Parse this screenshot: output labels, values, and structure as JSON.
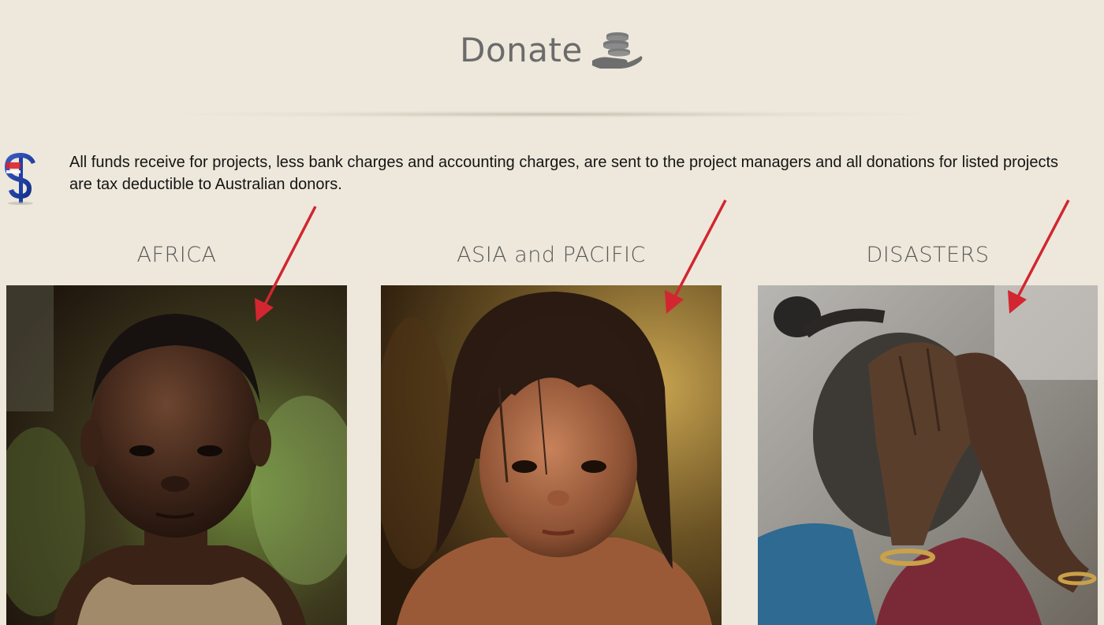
{
  "header": {
    "title": "Donate",
    "icon": "hand-coins-icon"
  },
  "intro": {
    "icon": "dollar-sign-icon",
    "text": "All funds receive for projects, less bank charges and accounting charges, are sent to the project managers and all donations for listed projects are tax deductible to Australian donors."
  },
  "regions": [
    {
      "label": "AFRICA",
      "photo": "child-portrait-photo"
    },
    {
      "label": "ASIA and PACIFIC",
      "photo": "girl-portrait-photo"
    },
    {
      "label": "DISASTERS",
      "photo": "grieving-woman-photo"
    }
  ],
  "colors": {
    "background": "#ede8db",
    "arrow": "#d22630",
    "title_text": "#5a5a5a"
  }
}
